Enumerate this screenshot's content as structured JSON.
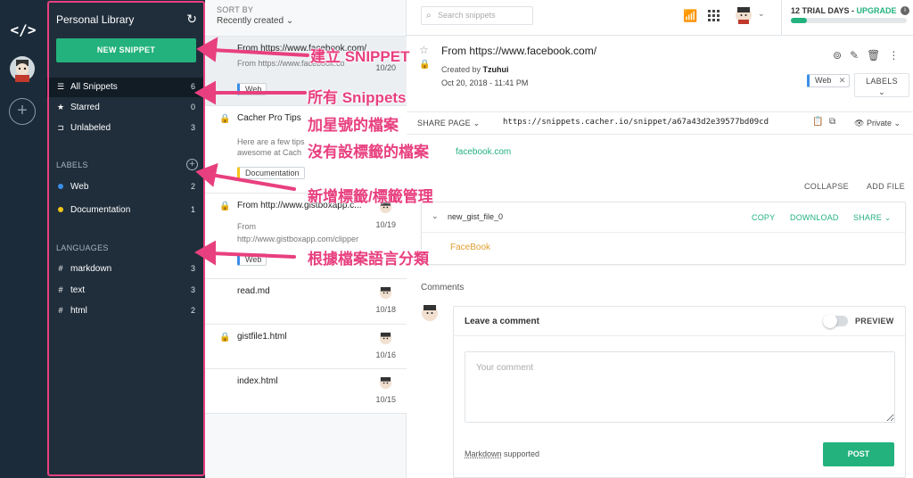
{
  "sidebar": {
    "title": "Personal Library",
    "new_snippet": "NEW SNIPPET",
    "nav": [
      {
        "label": "All Snippets",
        "count": "6",
        "icon": "list-icon"
      },
      {
        "label": "Starred",
        "count": "0",
        "icon": "star-icon"
      },
      {
        "label": "Unlabeled",
        "count": "3",
        "icon": "tag-outline-icon"
      }
    ],
    "labels_title": "LABELS",
    "labels": [
      {
        "label": "Web",
        "count": "2",
        "color": "#3b8ee8"
      },
      {
        "label": "Documentation",
        "count": "1",
        "color": "#f5c518"
      }
    ],
    "languages_title": "LANGUAGES",
    "languages": [
      {
        "label": "markdown",
        "count": "3"
      },
      {
        "label": "text",
        "count": "3"
      },
      {
        "label": "html",
        "count": "2"
      }
    ]
  },
  "list": {
    "sort_label": "SORT BY",
    "sort_value": "Recently created",
    "items": [
      {
        "title": "From https://www.facebook.com/",
        "desc": "From https://www.facebook.com/",
        "date": "10/20",
        "tag": "Web"
      },
      {
        "title": "Cacher Pro Tips",
        "desc1": "Here are a few tips",
        "desc2": "awesome at Cach",
        "tag": "Documentation"
      },
      {
        "title": "From http://www.gistboxapp.c...",
        "desc1": "From",
        "desc2": "http://www.gistboxapp.com/clipper",
        "date": "10/19",
        "tag": "Web"
      },
      {
        "title": "read.md",
        "date": "10/18"
      },
      {
        "title": "gistfile1.html",
        "date": "10/16"
      },
      {
        "title": "index.html",
        "date": "10/15"
      }
    ]
  },
  "topbar": {
    "search_placeholder": "Search snippets",
    "trial_days": "12 TRIAL DAYS",
    "upgrade": "UPGRADE",
    "trial_progress": 0.14
  },
  "detail": {
    "title": "From https://www.facebook.com/",
    "created_by_label": "Created by",
    "author": "Tzuhui",
    "date": "Oct 20, 2018 - 11:41 PM",
    "tag": "Web",
    "labels_btn": "LABELS",
    "share_page": "SHARE PAGE",
    "share_url": "https://snippets.cacher.io/snippet/a67a43d2e39577bd09cd",
    "privacy": "Private",
    "description_link": "facebook.com",
    "collapse": "COLLAPSE",
    "add_file": "ADD FILE",
    "file": {
      "name": "new_gist_file_0",
      "copy": "COPY",
      "download": "DOWNLOAD",
      "share": "SHARE",
      "code": "FaceBook"
    }
  },
  "comments": {
    "title": "Comments",
    "leave": "Leave a comment",
    "preview": "PREVIEW",
    "placeholder": "Your comment",
    "markdown": "Markdown",
    "supported": "supported",
    "post": "POST"
  },
  "annotations": [
    "建立 SNIPPET",
    "所有 Snippets",
    "加星號的檔案",
    "沒有設標籤的檔案",
    "新增標籤/標籤管理",
    "根據檔案語言分類"
  ]
}
